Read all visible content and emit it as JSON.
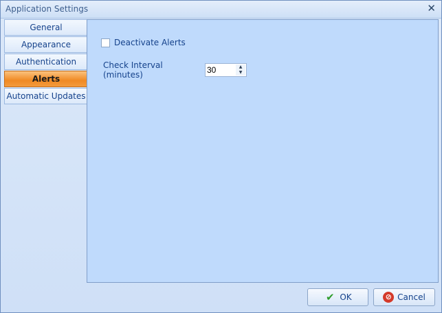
{
  "window": {
    "title": "Application Settings",
    "close_glyph": "✕"
  },
  "tabs": [
    {
      "label": "General",
      "active": false
    },
    {
      "label": "Appearance",
      "active": false
    },
    {
      "label": "Authentication",
      "active": false
    },
    {
      "label": "Alerts",
      "active": true
    },
    {
      "label": "Automatic Updates",
      "active": false
    }
  ],
  "alerts": {
    "deactivate_label": "Deactivate Alerts",
    "deactivate_checked": false,
    "interval_label": "Check Interval (minutes)",
    "interval_value": "30"
  },
  "buttons": {
    "ok_label": "OK",
    "cancel_label": "Cancel"
  },
  "colors": {
    "active_tab": "#f08a24",
    "panel_bg": "#bfdafc",
    "text": "#15428b"
  }
}
